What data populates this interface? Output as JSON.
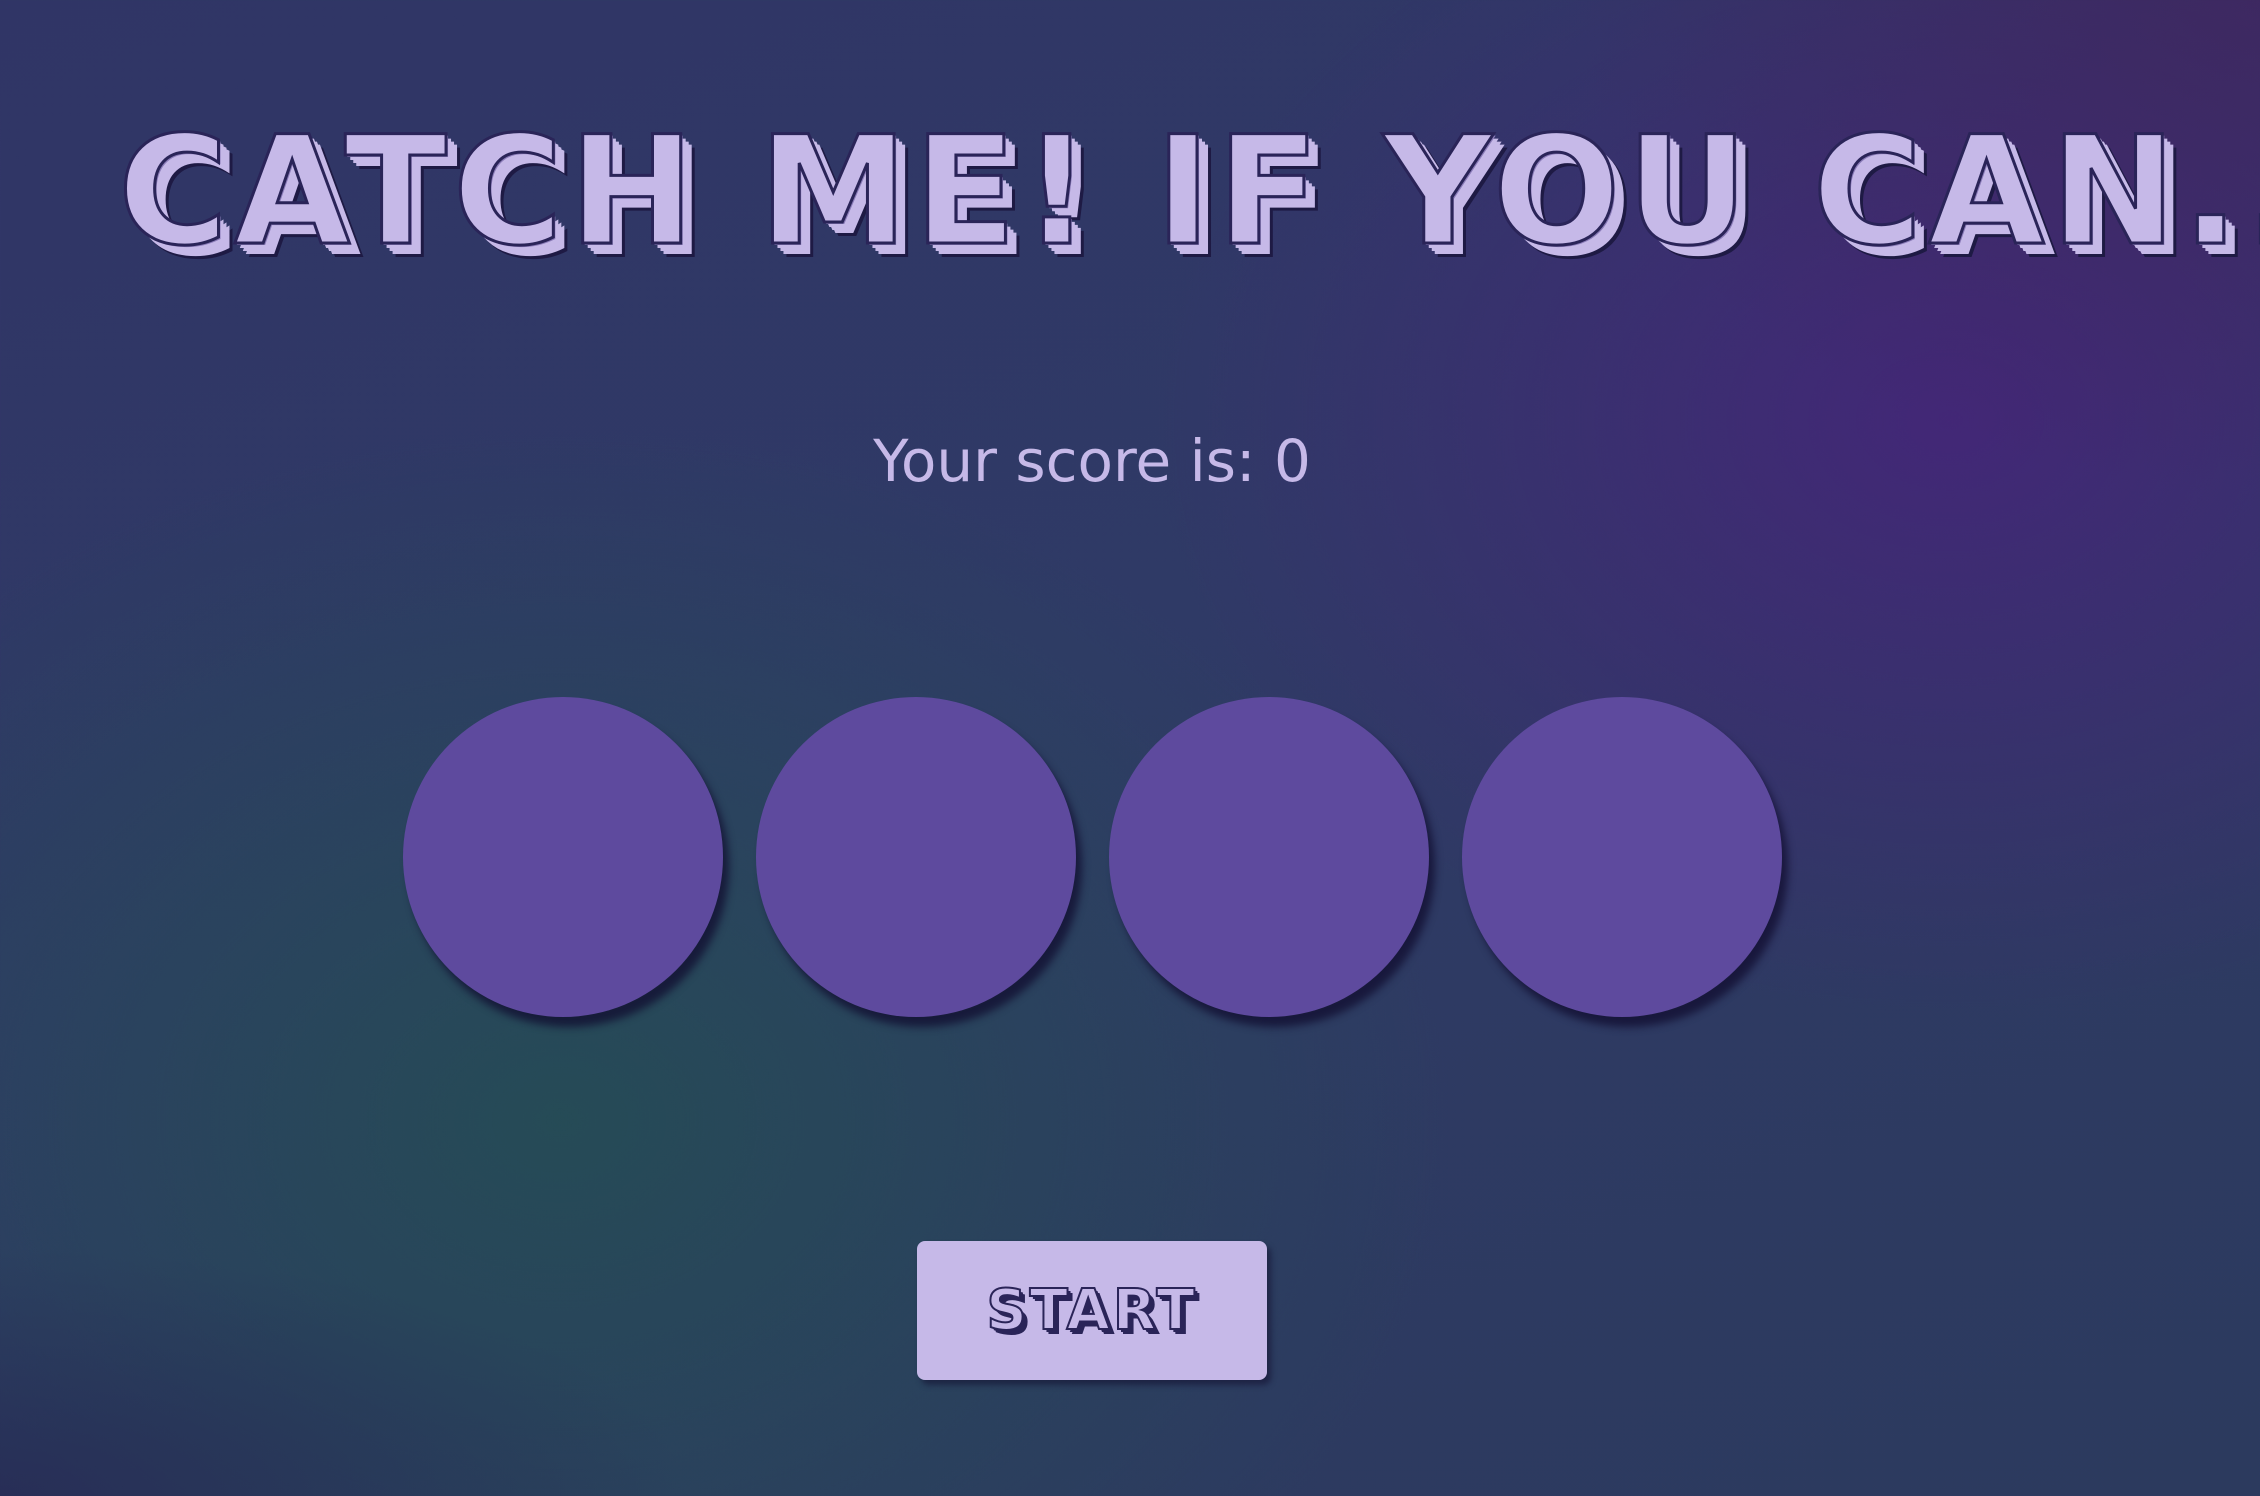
{
  "game": {
    "title": "CATCH ME! IF YOU CAN...",
    "score_text": "Your score is: 0",
    "score": 0,
    "holes": [
      {
        "id": 1
      },
      {
        "id": 2
      },
      {
        "id": 3
      },
      {
        "id": 4
      }
    ],
    "start_label": "START"
  },
  "colors": {
    "title_fill": "#c6b9e8",
    "title_outline": "#2a2458",
    "hole_fill": "#5e4a9e",
    "button_fill": "#c6b9e8",
    "background_teal": "#244e54",
    "background_purple": "#46247a"
  }
}
